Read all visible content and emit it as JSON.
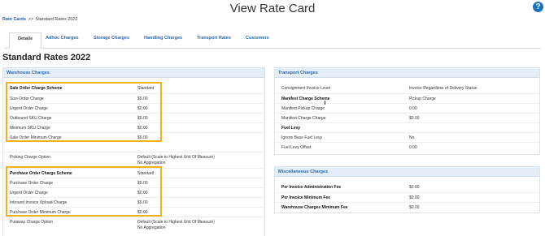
{
  "header": {
    "title": "View Rate Card",
    "help_glyph": "?"
  },
  "breadcrumb": {
    "root": "Rate Cards",
    "separator": ">>",
    "current": "Standard Rates 2022"
  },
  "tabs": [
    {
      "label": "Details",
      "active": true
    },
    {
      "label": "Adhoc Charges",
      "active": false
    },
    {
      "label": "Storage Charges",
      "active": false
    },
    {
      "label": "Handling Charges",
      "active": false
    },
    {
      "label": "Transport Rates",
      "active": false
    },
    {
      "label": "Customers",
      "active": false
    }
  ],
  "section_title": "Standard Rates 2022",
  "warehouse": {
    "title": "Warehouse Charges",
    "rows": [
      {
        "label": "Sale Order Charge Scheme",
        "value": "Standard",
        "bold": true
      },
      {
        "label": "Size Order Charge",
        "value": "$0.00"
      },
      {
        "label": "Urgent Order Charge",
        "value": "$0.00"
      },
      {
        "label": "Outbound SKU Charge",
        "value": "$0.00"
      },
      {
        "label": "Minimum SKU Charge",
        "value": "$0.00"
      },
      {
        "label": "Sale Order Minimum Charge",
        "value": "$0.00"
      },
      {
        "label": "Picking Charge Option",
        "value": "Default (Scale to Highest Unit Of Measure)",
        "value2": "No Aggregation"
      },
      {
        "label": "Purchase Order Charge Scheme",
        "value": "Standard",
        "bold": true
      },
      {
        "label": "Purchase Order Charge",
        "value": "$0.00"
      },
      {
        "label": "Urgent Order Charge",
        "value": "$0.00"
      },
      {
        "label": "Inbound Invoice Upload Charge",
        "value": "$0.00"
      },
      {
        "label": "Purchase Order Minimum Charge",
        "value": "$0.00"
      },
      {
        "label": "Putaway Charge Option",
        "value": "Default (Scale to Highest Unit Of Measure)",
        "value2": "No Aggregation"
      }
    ]
  },
  "transport": {
    "title": "Transport Charges",
    "rows": [
      {
        "label": "Consignment Invoice Level",
        "value": "Invoice Regardless of Delivery Status"
      },
      {
        "label": "Manifest Charge Scheme",
        "value": "Pickup Charge",
        "bold": true
      },
      {
        "label": "Manifest Pickup Charge",
        "value": "0.00"
      },
      {
        "label": "Manifest Charge Charge",
        "value": "$0.00"
      },
      {
        "label": "Fuel Levy",
        "value": "",
        "bold": true
      },
      {
        "label": "Ignore Base Fuel Levy",
        "value": "No"
      },
      {
        "label": "Fuel Levy Offset",
        "value": "0.00"
      }
    ]
  },
  "misc": {
    "title": "Miscellaneous Charges",
    "rows": [
      {
        "label": "Per Invoice Administration Fee",
        "value": "$0.00",
        "bold": true
      },
      {
        "label": "Per Invoice Minimum Fee",
        "value": "$0.00",
        "bold": true
      },
      {
        "label": "Warehouse Charges Minimum Fee",
        "value": "$0.00",
        "bold": true
      }
    ]
  },
  "colors": {
    "accent": "#2a67b0",
    "panel_header": "#e4eef7",
    "highlight": "#f2b120"
  }
}
